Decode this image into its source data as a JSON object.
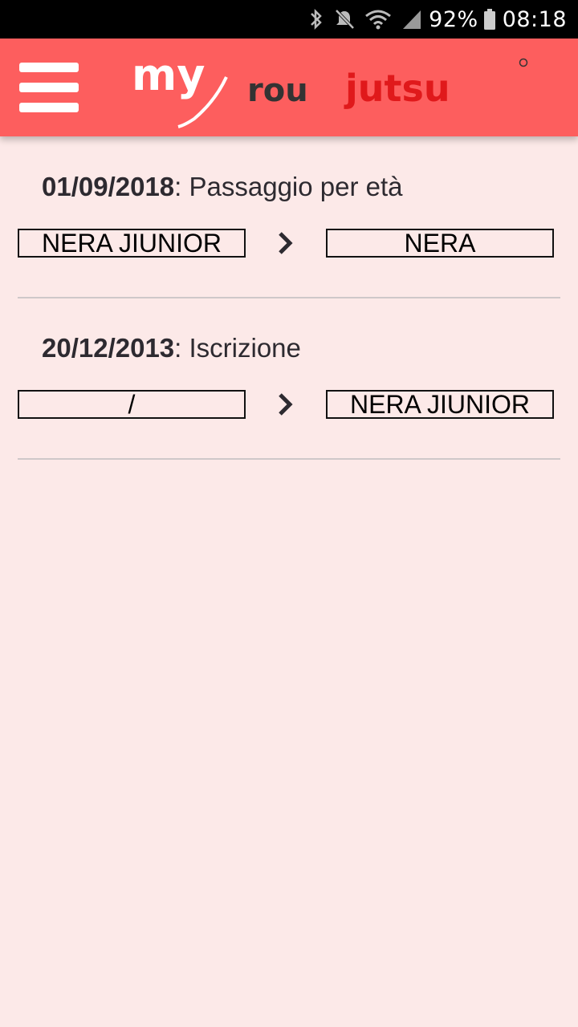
{
  "status_bar": {
    "icons": [
      "bluetooth-icon",
      "mute-icon",
      "wifi-icon",
      "signal-icon",
      "battery-icon"
    ],
    "battery_percent": "92%",
    "time": "08:18"
  },
  "app_bar": {
    "menu_icon": "hamburger-menu-icon",
    "logo": {
      "part1": "my",
      "part2": "rou",
      "part3": "jutsu"
    },
    "colors": {
      "bar": "#fd5e5e",
      "logo_white": "#ffffff",
      "logo_dark": "#333333",
      "logo_red": "#e0191b"
    }
  },
  "history": [
    {
      "date": "01/09/2018",
      "event": ": Passaggio per età",
      "from_belt": "NERA JIUNIOR",
      "to_belt": "NERA"
    },
    {
      "date": "20/12/2013",
      "event": ": Iscrizione",
      "from_belt": "/",
      "to_belt": "NERA JIUNIOR"
    }
  ],
  "colors": {
    "background": "#fce9e8",
    "divider": "#cfc8c9"
  }
}
